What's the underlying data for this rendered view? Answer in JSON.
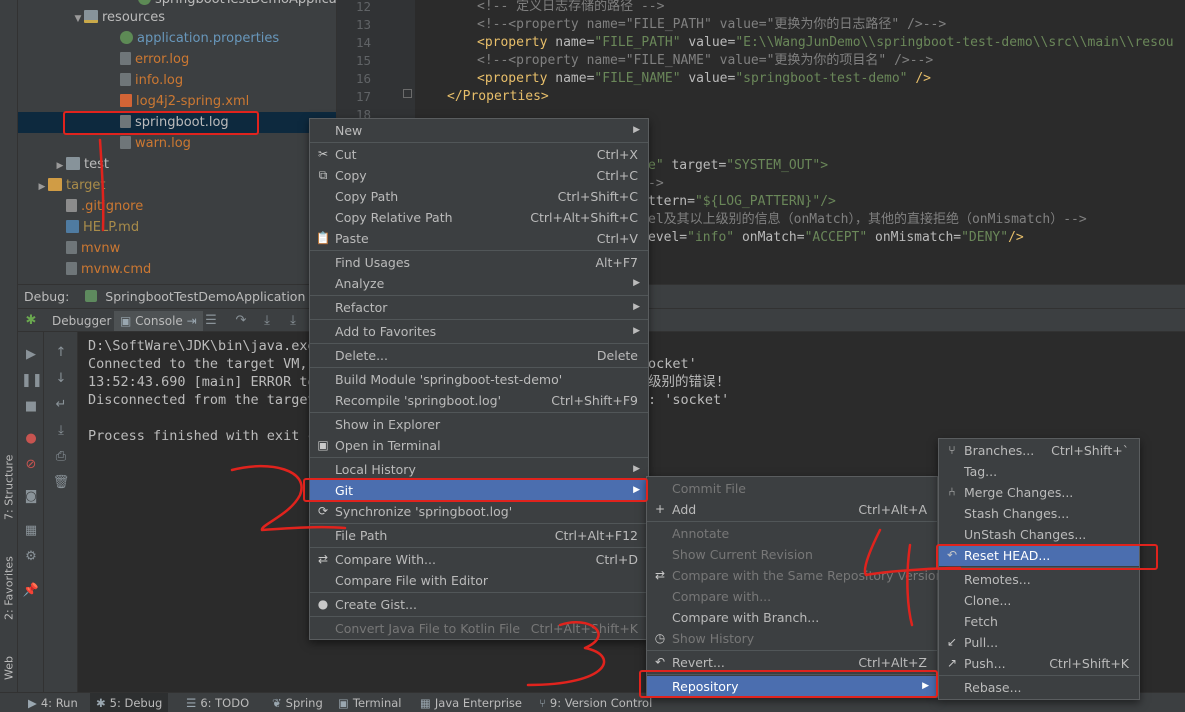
{
  "project_tree": [
    {
      "label": "springbootTestDemoApplication",
      "indent": 0,
      "icon": "java-class-icon",
      "arrow": "",
      "color": "#bbbbbb"
    },
    {
      "label": "resources",
      "icon": "resources-folder-icon",
      "arrow": "▼",
      "color": "#bbbbbb"
    },
    {
      "label": "application.properties",
      "icon": "properties-file-icon",
      "arrow": "",
      "color": "#6897bb"
    },
    {
      "label": "error.log",
      "icon": "log-file-icon",
      "arrow": "",
      "color": "#cc7832"
    },
    {
      "label": "info.log",
      "icon": "log-file-icon",
      "arrow": "",
      "color": "#cc7832"
    },
    {
      "label": "log4j2-spring.xml",
      "icon": "xml-file-icon",
      "arrow": "",
      "color": "#cc7832"
    },
    {
      "label": "springboot.log",
      "icon": "log-file-icon",
      "arrow": "",
      "color": "#bbbbbb"
    },
    {
      "label": "warn.log",
      "icon": "log-file-icon",
      "arrow": "",
      "color": "#cc7832"
    },
    {
      "label": "test",
      "icon": "folder-icon",
      "arrow": "▶",
      "color": "#bbbbbb"
    },
    {
      "label": "target",
      "icon": "target-folder-icon",
      "arrow": "▶",
      "color": "#a98c4a"
    },
    {
      "label": ".gitignore",
      "icon": "gitignore-file-icon",
      "arrow": "",
      "color": "#cc7832"
    },
    {
      "label": "HELP.md",
      "icon": "markdown-file-icon",
      "arrow": "",
      "color": "#a98c4a"
    },
    {
      "label": "mvnw",
      "icon": "file-icon",
      "arrow": "",
      "color": "#cc7832"
    },
    {
      "label": "mvnw.cmd",
      "icon": "file-icon",
      "arrow": "",
      "color": "#cc7832"
    }
  ],
  "editor": {
    "line_numbers": [
      "12",
      "13",
      "14",
      "15",
      "16",
      "17",
      "18"
    ],
    "lines": [
      {
        "comment": "<!-- 定义日志存储的路径 -->"
      },
      {
        "comment": "<!--<property name=\"FILE_PATH\" value=\"更换为你的日志路径\" />-->"
      },
      {
        "tag": "<property ",
        "attr1": "name=",
        "val1": "\"FILE_PATH\" ",
        "attr2": "value=",
        "val2": "\"E:\\\\WangJunDemo\\\\springboot-test-demo\\\\src\\\\main\\\\resou"
      },
      {
        "comment": "<!--<property name=\"FILE_NAME\" value=\"更换为你的项目名\" />-->"
      },
      {
        "tag": "<property ",
        "attr1": "name=",
        "val1": "\"FILE_NAME\" ",
        "attr2": "value=",
        "val2": "\"springboot-test-demo\" ",
        "tag_end": "/>"
      },
      {
        "tag": "</Properties>"
      }
    ],
    "partial_lines": [
      {
        "text_val": "e\" ",
        "text_attr": "target=",
        "text_val2": "\"SYSTEM_OUT\">"
      },
      {
        "comment": "->"
      },
      {
        "text_attr": "ttern=",
        "text_val2": "\"${LOG_PATTERN}\"/>"
      },
      {
        "comment": "el及其以上级别的信息（onMatch），其他的直接拒绝（onMismatch）-->"
      },
      {
        "text_attr": "evel=",
        "text_val": "\"info\" ",
        "text_attr2": "onMatch=",
        "text_val2": "\"ACCEPT\" ",
        "text_attr3": "onMismatch=",
        "text_val3": "\"DENY\"",
        "text_end": "/>"
      }
    ]
  },
  "debug": {
    "label": "Debug:",
    "config_name": "SpringbootTestDemoApplication",
    "tabs": [
      "Debugger",
      "Console"
    ]
  },
  "console_lines": [
    "D:\\SoftWare\\JDK\\bin\\java.exe",
    "Connected to the target VM,",
    "13:52:43.690 [main] ERROR to",
    "Disconnected from the target",
    "",
    "Process finished with exit c"
  ],
  "console_right": [
    "ocket'",
    "级别的错误!",
    ": 'socket'"
  ],
  "context_menu": [
    {
      "label": "New",
      "shortcut": "",
      "submenu": true,
      "icon": ""
    },
    {
      "sep": true
    },
    {
      "label": "Cut",
      "shortcut": "Ctrl+X",
      "icon": "✂"
    },
    {
      "label": "Copy",
      "shortcut": "Ctrl+C",
      "icon": "⧉"
    },
    {
      "label": "Copy Path",
      "shortcut": "Ctrl+Shift+C",
      "icon": ""
    },
    {
      "label": "Copy Relative Path",
      "shortcut": "Ctrl+Alt+Shift+C",
      "icon": ""
    },
    {
      "label": "Paste",
      "shortcut": "Ctrl+V",
      "icon": "📋"
    },
    {
      "sep": true
    },
    {
      "label": "Find Usages",
      "shortcut": "Alt+F7",
      "icon": ""
    },
    {
      "label": "Analyze",
      "shortcut": "",
      "submenu": true,
      "icon": ""
    },
    {
      "sep": true
    },
    {
      "label": "Refactor",
      "shortcut": "",
      "submenu": true,
      "icon": ""
    },
    {
      "sep": true
    },
    {
      "label": "Add to Favorites",
      "shortcut": "",
      "submenu": true,
      "icon": ""
    },
    {
      "sep": true
    },
    {
      "label": "Delete...",
      "shortcut": "Delete",
      "icon": ""
    },
    {
      "sep": true
    },
    {
      "label": "Build Module 'springboot-test-demo'",
      "shortcut": "",
      "icon": ""
    },
    {
      "label": "Recompile 'springboot.log'",
      "shortcut": "Ctrl+Shift+F9",
      "icon": ""
    },
    {
      "sep": true
    },
    {
      "label": "Show in Explorer",
      "shortcut": "",
      "icon": ""
    },
    {
      "label": "Open in Terminal",
      "shortcut": "",
      "icon": "▣"
    },
    {
      "sep": true
    },
    {
      "label": "Local History",
      "shortcut": "",
      "submenu": true,
      "icon": ""
    },
    {
      "label": "Git",
      "shortcut": "",
      "submenu": true,
      "icon": "",
      "highlight": true
    },
    {
      "label": "Synchronize 'springboot.log'",
      "shortcut": "",
      "icon": "⟳"
    },
    {
      "sep": true
    },
    {
      "label": "File Path",
      "shortcut": "Ctrl+Alt+F12",
      "icon": ""
    },
    {
      "sep": true
    },
    {
      "label": "Compare With...",
      "shortcut": "Ctrl+D",
      "icon": "⇄"
    },
    {
      "label": "Compare File with Editor",
      "shortcut": "",
      "icon": ""
    },
    {
      "sep": true
    },
    {
      "label": "Create Gist...",
      "shortcut": "",
      "icon": "●"
    },
    {
      "sep": true
    },
    {
      "label": "Convert Java File to Kotlin File",
      "shortcut": "Ctrl+Alt+Shift+K",
      "icon": "",
      "disabled": true
    }
  ],
  "git_menu": [
    {
      "label": "Commit File",
      "shortcut": "",
      "disabled": true,
      "icon": ""
    },
    {
      "label": "Add",
      "shortcut": "Ctrl+Alt+A",
      "icon": "+"
    },
    {
      "sep": true
    },
    {
      "label": "Annotate",
      "shortcut": "",
      "disabled": true,
      "icon": ""
    },
    {
      "label": "Show Current Revision",
      "shortcut": "",
      "disabled": true,
      "icon": ""
    },
    {
      "label": "Compare with the Same Repository Version",
      "shortcut": "",
      "disabled": true,
      "icon": "⇄"
    },
    {
      "label": "Compare with...",
      "shortcut": "",
      "disabled": true,
      "icon": ""
    },
    {
      "label": "Compare with Branch...",
      "shortcut": "",
      "icon": ""
    },
    {
      "label": "Show History",
      "shortcut": "",
      "disabled": true,
      "icon": "◷"
    },
    {
      "sep": true
    },
    {
      "label": "Revert...",
      "shortcut": "Ctrl+Alt+Z",
      "icon": "↶"
    },
    {
      "sep": true
    },
    {
      "label": "Repository",
      "shortcut": "",
      "submenu": true,
      "highlight": true,
      "icon": ""
    }
  ],
  "repo_menu": [
    {
      "label": "Branches...",
      "shortcut": "Ctrl+Shift+`",
      "icon": "⑂"
    },
    {
      "label": "Tag...",
      "shortcut": "",
      "icon": ""
    },
    {
      "label": "Merge Changes...",
      "shortcut": "",
      "icon": "⑃"
    },
    {
      "label": "Stash Changes...",
      "shortcut": "",
      "icon": ""
    },
    {
      "label": "UnStash Changes...",
      "shortcut": "",
      "icon": ""
    },
    {
      "label": "Reset HEAD...",
      "shortcut": "",
      "highlight": true,
      "icon": "↶"
    },
    {
      "sep": true
    },
    {
      "label": "Remotes...",
      "shortcut": "",
      "icon": ""
    },
    {
      "label": "Clone...",
      "shortcut": "",
      "icon": ""
    },
    {
      "label": "Fetch",
      "shortcut": "",
      "icon": ""
    },
    {
      "label": "Pull...",
      "shortcut": "",
      "icon": "↙"
    },
    {
      "label": "Push...",
      "shortcut": "Ctrl+Shift+K",
      "icon": "↗"
    },
    {
      "sep": true
    },
    {
      "label": "Rebase...",
      "shortcut": "",
      "icon": ""
    }
  ],
  "status_tabs": [
    {
      "label": "4: Run",
      "icon": "▶"
    },
    {
      "label": "5: Debug",
      "icon": "✱",
      "active": true
    },
    {
      "label": "6: TODO",
      "icon": "☰"
    },
    {
      "label": "Spring",
      "icon": "❦"
    },
    {
      "label": "Terminal",
      "icon": "▣"
    },
    {
      "label": "Java Enterprise",
      "icon": "▦"
    },
    {
      "label": "9: Version Control",
      "icon": "⑂"
    }
  ],
  "side_tabs": [
    "7: Structure",
    "2: Favorites",
    "Web"
  ],
  "colors": {
    "accent": "#4b6eaf",
    "annotation": "#e0231d"
  }
}
